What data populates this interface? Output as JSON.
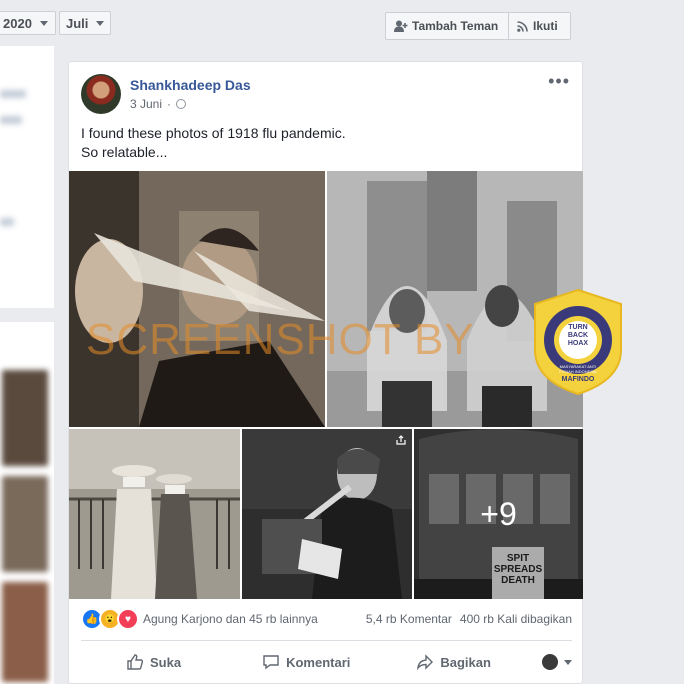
{
  "filters": {
    "year": "2020",
    "month": "Juli"
  },
  "profile_actions": {
    "add_friend": "Tambah Teman",
    "follow": "Ikuti"
  },
  "post": {
    "author": "Shankhadeep Das",
    "date": "3 Juni",
    "text_line1": "I found these photos of 1918 flu pandemic.",
    "text_line2": "So relatable...",
    "more_photos": "+9",
    "watermark": "SCREENSHOT BY",
    "badge_logo": "TURN BACK HOAX",
    "badge_ring": "MASYARAKAT ANTI FITNAH INDONESIA",
    "badge_bottom": "MAFINDO",
    "sign_text": "SPIT SPREADS DEATH",
    "reactions_text": "Agung Karjono dan 45 rb lainnya",
    "comments_count": "5,4 rb Komentar",
    "shares_count": "400 rb Kali dibagikan",
    "actions": {
      "like": "Suka",
      "comment": "Komentari",
      "share": "Bagikan"
    }
  },
  "colors": {
    "link": "#385898",
    "like": "#1877f2",
    "love": "#f33e58",
    "wow": "#f7b125",
    "badge": "#f4d23e"
  }
}
